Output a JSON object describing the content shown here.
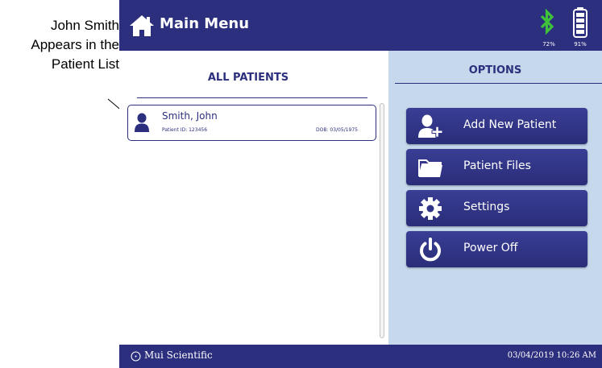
{
  "annotation": {
    "lines": [
      "John Smith",
      "Appears in the",
      "Patient List"
    ]
  },
  "header": {
    "title": "Main Menu",
    "home_icon": "home-icon",
    "bluetooth_icon": "bluetooth-icon",
    "bluetooth_percent": "72%",
    "battery_icon": "battery-icon",
    "battery_percent": "91%",
    "bluetooth_color": "#3fc23a",
    "bar_color": "#2c2f7d"
  },
  "patients_panel": {
    "heading": "ALL PATIENTS",
    "patients": [
      {
        "name": "Smith, John",
        "id_text": "Patient ID: 123456",
        "dob_text": "DOB: 03/05/1975",
        "icon": "person-icon"
      }
    ]
  },
  "options_panel": {
    "heading": "OPTIONS",
    "background": "#c5d8ec",
    "buttons": [
      {
        "label": "Add New Patient",
        "icon": "add-person-icon"
      },
      {
        "label": "Patient Files",
        "icon": "folder-icon"
      },
      {
        "label": "Settings",
        "icon": "gear-icon"
      },
      {
        "label": "Power Off",
        "icon": "power-icon"
      }
    ]
  },
  "footer": {
    "brand": "Mui Scientific",
    "brand_icon": "brand-logo-icon",
    "datetime": "03/04/2019 10:26 AM"
  }
}
